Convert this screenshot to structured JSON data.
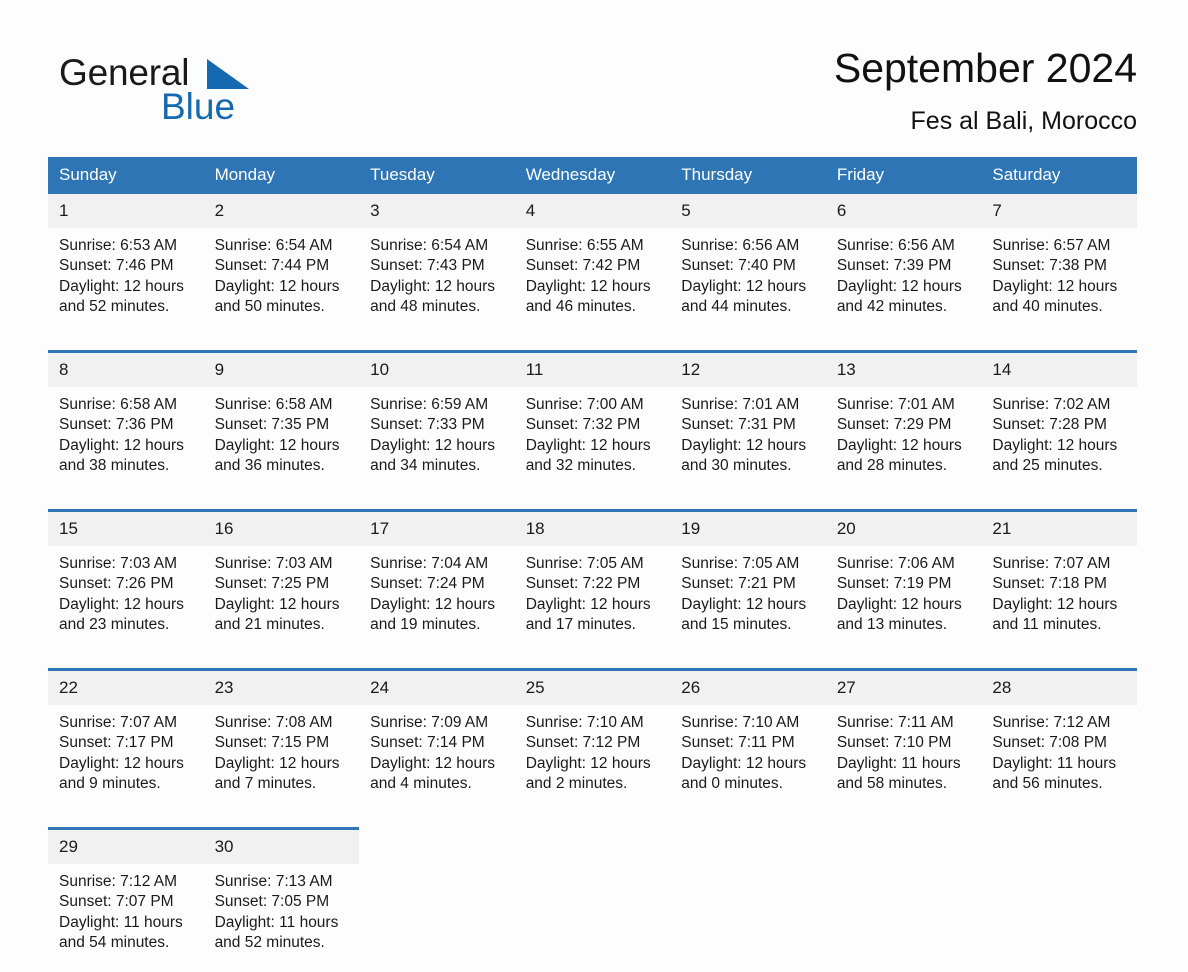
{
  "brand": {
    "name_part1": "General",
    "name_part2": "Blue",
    "triangle_icon": "brand-triangle-icon",
    "accent_color": "#1569b0"
  },
  "header": {
    "month_title": "September 2024",
    "location": "Fes al Bali, Morocco"
  },
  "colors": {
    "header_blue": "#2e75b6",
    "daynum_band": "#f1f1f1",
    "page_background": "#fdfdfd",
    "text": "#1a1a1a"
  },
  "calendar": {
    "weekday_headers": [
      "Sunday",
      "Monday",
      "Tuesday",
      "Wednesday",
      "Thursday",
      "Friday",
      "Saturday"
    ],
    "weeks": [
      [
        {
          "day": "1",
          "sunrise": "Sunrise: 6:53 AM",
          "sunset": "Sunset: 7:46 PM",
          "daylight_line1": "Daylight: 12 hours",
          "daylight_line2": "and 52 minutes."
        },
        {
          "day": "2",
          "sunrise": "Sunrise: 6:54 AM",
          "sunset": "Sunset: 7:44 PM",
          "daylight_line1": "Daylight: 12 hours",
          "daylight_line2": "and 50 minutes."
        },
        {
          "day": "3",
          "sunrise": "Sunrise: 6:54 AM",
          "sunset": "Sunset: 7:43 PM",
          "daylight_line1": "Daylight: 12 hours",
          "daylight_line2": "and 48 minutes."
        },
        {
          "day": "4",
          "sunrise": "Sunrise: 6:55 AM",
          "sunset": "Sunset: 7:42 PM",
          "daylight_line1": "Daylight: 12 hours",
          "daylight_line2": "and 46 minutes."
        },
        {
          "day": "5",
          "sunrise": "Sunrise: 6:56 AM",
          "sunset": "Sunset: 7:40 PM",
          "daylight_line1": "Daylight: 12 hours",
          "daylight_line2": "and 44 minutes."
        },
        {
          "day": "6",
          "sunrise": "Sunrise: 6:56 AM",
          "sunset": "Sunset: 7:39 PM",
          "daylight_line1": "Daylight: 12 hours",
          "daylight_line2": "and 42 minutes."
        },
        {
          "day": "7",
          "sunrise": "Sunrise: 6:57 AM",
          "sunset": "Sunset: 7:38 PM",
          "daylight_line1": "Daylight: 12 hours",
          "daylight_line2": "and 40 minutes."
        }
      ],
      [
        {
          "day": "8",
          "sunrise": "Sunrise: 6:58 AM",
          "sunset": "Sunset: 7:36 PM",
          "daylight_line1": "Daylight: 12 hours",
          "daylight_line2": "and 38 minutes."
        },
        {
          "day": "9",
          "sunrise": "Sunrise: 6:58 AM",
          "sunset": "Sunset: 7:35 PM",
          "daylight_line1": "Daylight: 12 hours",
          "daylight_line2": "and 36 minutes."
        },
        {
          "day": "10",
          "sunrise": "Sunrise: 6:59 AM",
          "sunset": "Sunset: 7:33 PM",
          "daylight_line1": "Daylight: 12 hours",
          "daylight_line2": "and 34 minutes."
        },
        {
          "day": "11",
          "sunrise": "Sunrise: 7:00 AM",
          "sunset": "Sunset: 7:32 PM",
          "daylight_line1": "Daylight: 12 hours",
          "daylight_line2": "and 32 minutes."
        },
        {
          "day": "12",
          "sunrise": "Sunrise: 7:01 AM",
          "sunset": "Sunset: 7:31 PM",
          "daylight_line1": "Daylight: 12 hours",
          "daylight_line2": "and 30 minutes."
        },
        {
          "day": "13",
          "sunrise": "Sunrise: 7:01 AM",
          "sunset": "Sunset: 7:29 PM",
          "daylight_line1": "Daylight: 12 hours",
          "daylight_line2": "and 28 minutes."
        },
        {
          "day": "14",
          "sunrise": "Sunrise: 7:02 AM",
          "sunset": "Sunset: 7:28 PM",
          "daylight_line1": "Daylight: 12 hours",
          "daylight_line2": "and 25 minutes."
        }
      ],
      [
        {
          "day": "15",
          "sunrise": "Sunrise: 7:03 AM",
          "sunset": "Sunset: 7:26 PM",
          "daylight_line1": "Daylight: 12 hours",
          "daylight_line2": "and 23 minutes."
        },
        {
          "day": "16",
          "sunrise": "Sunrise: 7:03 AM",
          "sunset": "Sunset: 7:25 PM",
          "daylight_line1": "Daylight: 12 hours",
          "daylight_line2": "and 21 minutes."
        },
        {
          "day": "17",
          "sunrise": "Sunrise: 7:04 AM",
          "sunset": "Sunset: 7:24 PM",
          "daylight_line1": "Daylight: 12 hours",
          "daylight_line2": "and 19 minutes."
        },
        {
          "day": "18",
          "sunrise": "Sunrise: 7:05 AM",
          "sunset": "Sunset: 7:22 PM",
          "daylight_line1": "Daylight: 12 hours",
          "daylight_line2": "and 17 minutes."
        },
        {
          "day": "19",
          "sunrise": "Sunrise: 7:05 AM",
          "sunset": "Sunset: 7:21 PM",
          "daylight_line1": "Daylight: 12 hours",
          "daylight_line2": "and 15 minutes."
        },
        {
          "day": "20",
          "sunrise": "Sunrise: 7:06 AM",
          "sunset": "Sunset: 7:19 PM",
          "daylight_line1": "Daylight: 12 hours",
          "daylight_line2": "and 13 minutes."
        },
        {
          "day": "21",
          "sunrise": "Sunrise: 7:07 AM",
          "sunset": "Sunset: 7:18 PM",
          "daylight_line1": "Daylight: 12 hours",
          "daylight_line2": "and 11 minutes."
        }
      ],
      [
        {
          "day": "22",
          "sunrise": "Sunrise: 7:07 AM",
          "sunset": "Sunset: 7:17 PM",
          "daylight_line1": "Daylight: 12 hours",
          "daylight_line2": "and 9 minutes."
        },
        {
          "day": "23",
          "sunrise": "Sunrise: 7:08 AM",
          "sunset": "Sunset: 7:15 PM",
          "daylight_line1": "Daylight: 12 hours",
          "daylight_line2": "and 7 minutes."
        },
        {
          "day": "24",
          "sunrise": "Sunrise: 7:09 AM",
          "sunset": "Sunset: 7:14 PM",
          "daylight_line1": "Daylight: 12 hours",
          "daylight_line2": "and 4 minutes."
        },
        {
          "day": "25",
          "sunrise": "Sunrise: 7:10 AM",
          "sunset": "Sunset: 7:12 PM",
          "daylight_line1": "Daylight: 12 hours",
          "daylight_line2": "and 2 minutes."
        },
        {
          "day": "26",
          "sunrise": "Sunrise: 7:10 AM",
          "sunset": "Sunset: 7:11 PM",
          "daylight_line1": "Daylight: 12 hours",
          "daylight_line2": "and 0 minutes."
        },
        {
          "day": "27",
          "sunrise": "Sunrise: 7:11 AM",
          "sunset": "Sunset: 7:10 PM",
          "daylight_line1": "Daylight: 11 hours",
          "daylight_line2": "and 58 minutes."
        },
        {
          "day": "28",
          "sunrise": "Sunrise: 7:12 AM",
          "sunset": "Sunset: 7:08 PM",
          "daylight_line1": "Daylight: 11 hours",
          "daylight_line2": "and 56 minutes."
        }
      ],
      [
        {
          "day": "29",
          "sunrise": "Sunrise: 7:12 AM",
          "sunset": "Sunset: 7:07 PM",
          "daylight_line1": "Daylight: 11 hours",
          "daylight_line2": "and 54 minutes."
        },
        {
          "day": "30",
          "sunrise": "Sunrise: 7:13 AM",
          "sunset": "Sunset: 7:05 PM",
          "daylight_line1": "Daylight: 11 hours",
          "daylight_line2": "and 52 minutes."
        },
        null,
        null,
        null,
        null,
        null
      ]
    ]
  }
}
